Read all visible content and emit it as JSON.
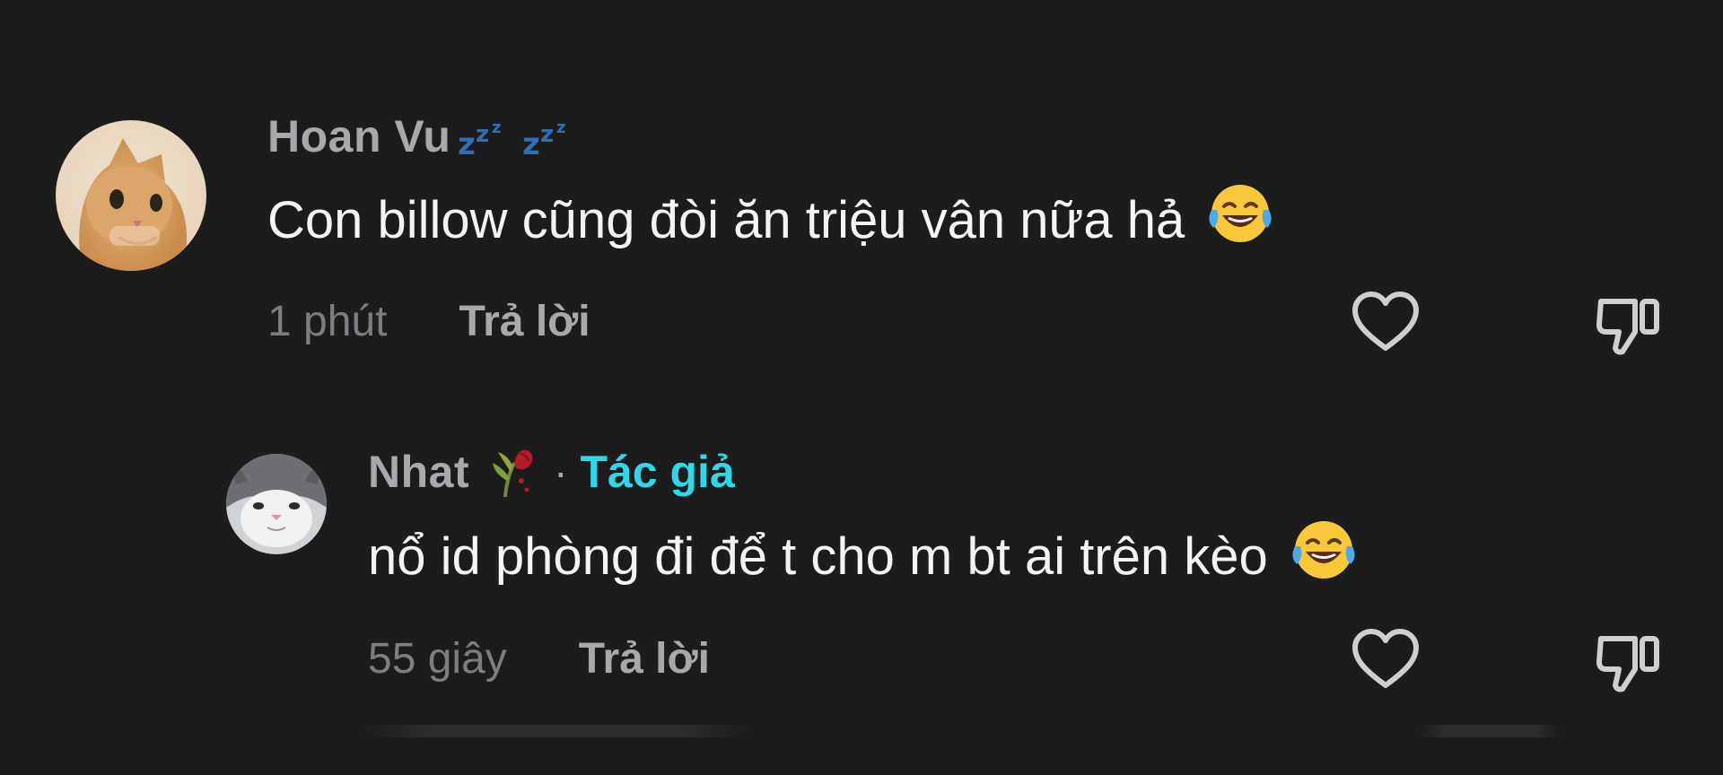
{
  "comments": [
    {
      "username": "Hoan Vu",
      "username_decoration": "zzz-icon",
      "text": "Con billow cũng đòi ăn triệu vân nữa hả",
      "emoji": "laughing-tears-emoji",
      "timestamp": "1 phút",
      "reply_label": "Trả lời",
      "avatar": "orange-cat-avatar"
    },
    {
      "username": "Nhat",
      "username_decoration": "wilted-rose-icon",
      "separator": "·",
      "badge": "Tác giả",
      "text": "nổ id phòng đi để t cho m bt ai trên kèo",
      "emoji": "laughing-tears-emoji",
      "timestamp": "55 giây",
      "reply_label": "Trả lời",
      "avatar": "gray-white-cat-avatar"
    }
  ],
  "icons": {
    "like": "heart-outline-icon",
    "dislike": "thumbs-down-outline-icon"
  },
  "colors": {
    "background": "#1c1c1c",
    "username": "#a9a9ad",
    "text": "#f4f4f4",
    "timestamp": "#7d7d82",
    "author_badge": "#2fd8e6",
    "icon": "#cfcfcf"
  }
}
